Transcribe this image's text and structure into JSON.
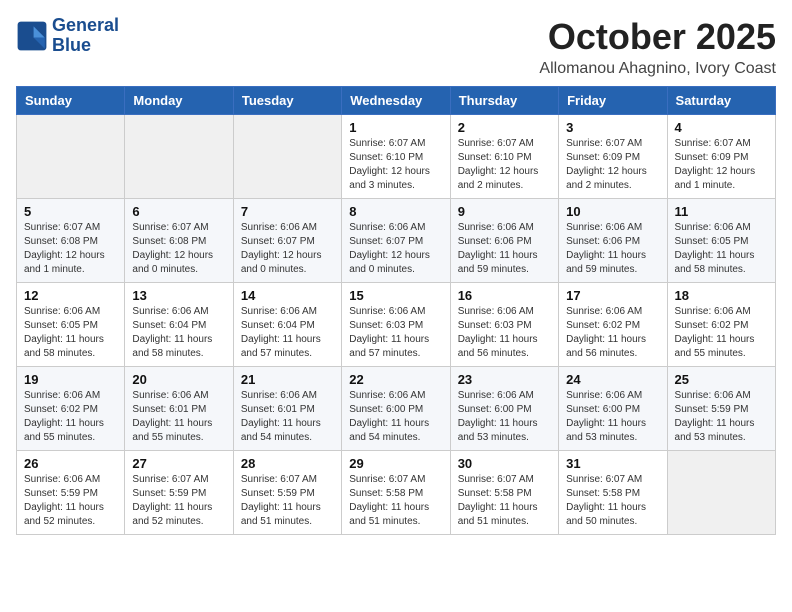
{
  "logo": {
    "line1": "General",
    "line2": "Blue"
  },
  "title": "October 2025",
  "subtitle": "Allomanou Ahagnino, Ivory Coast",
  "weekdays": [
    "Sunday",
    "Monday",
    "Tuesday",
    "Wednesday",
    "Thursday",
    "Friday",
    "Saturday"
  ],
  "weeks": [
    [
      {
        "day": "",
        "info": ""
      },
      {
        "day": "",
        "info": ""
      },
      {
        "day": "",
        "info": ""
      },
      {
        "day": "1",
        "info": "Sunrise: 6:07 AM\nSunset: 6:10 PM\nDaylight: 12 hours\nand 3 minutes."
      },
      {
        "day": "2",
        "info": "Sunrise: 6:07 AM\nSunset: 6:10 PM\nDaylight: 12 hours\nand 2 minutes."
      },
      {
        "day": "3",
        "info": "Sunrise: 6:07 AM\nSunset: 6:09 PM\nDaylight: 12 hours\nand 2 minutes."
      },
      {
        "day": "4",
        "info": "Sunrise: 6:07 AM\nSunset: 6:09 PM\nDaylight: 12 hours\nand 1 minute."
      }
    ],
    [
      {
        "day": "5",
        "info": "Sunrise: 6:07 AM\nSunset: 6:08 PM\nDaylight: 12 hours\nand 1 minute."
      },
      {
        "day": "6",
        "info": "Sunrise: 6:07 AM\nSunset: 6:08 PM\nDaylight: 12 hours\nand 0 minutes."
      },
      {
        "day": "7",
        "info": "Sunrise: 6:06 AM\nSunset: 6:07 PM\nDaylight: 12 hours\nand 0 minutes."
      },
      {
        "day": "8",
        "info": "Sunrise: 6:06 AM\nSunset: 6:07 PM\nDaylight: 12 hours\nand 0 minutes."
      },
      {
        "day": "9",
        "info": "Sunrise: 6:06 AM\nSunset: 6:06 PM\nDaylight: 11 hours\nand 59 minutes."
      },
      {
        "day": "10",
        "info": "Sunrise: 6:06 AM\nSunset: 6:06 PM\nDaylight: 11 hours\nand 59 minutes."
      },
      {
        "day": "11",
        "info": "Sunrise: 6:06 AM\nSunset: 6:05 PM\nDaylight: 11 hours\nand 58 minutes."
      }
    ],
    [
      {
        "day": "12",
        "info": "Sunrise: 6:06 AM\nSunset: 6:05 PM\nDaylight: 11 hours\nand 58 minutes."
      },
      {
        "day": "13",
        "info": "Sunrise: 6:06 AM\nSunset: 6:04 PM\nDaylight: 11 hours\nand 58 minutes."
      },
      {
        "day": "14",
        "info": "Sunrise: 6:06 AM\nSunset: 6:04 PM\nDaylight: 11 hours\nand 57 minutes."
      },
      {
        "day": "15",
        "info": "Sunrise: 6:06 AM\nSunset: 6:03 PM\nDaylight: 11 hours\nand 57 minutes."
      },
      {
        "day": "16",
        "info": "Sunrise: 6:06 AM\nSunset: 6:03 PM\nDaylight: 11 hours\nand 56 minutes."
      },
      {
        "day": "17",
        "info": "Sunrise: 6:06 AM\nSunset: 6:02 PM\nDaylight: 11 hours\nand 56 minutes."
      },
      {
        "day": "18",
        "info": "Sunrise: 6:06 AM\nSunset: 6:02 PM\nDaylight: 11 hours\nand 55 minutes."
      }
    ],
    [
      {
        "day": "19",
        "info": "Sunrise: 6:06 AM\nSunset: 6:02 PM\nDaylight: 11 hours\nand 55 minutes."
      },
      {
        "day": "20",
        "info": "Sunrise: 6:06 AM\nSunset: 6:01 PM\nDaylight: 11 hours\nand 55 minutes."
      },
      {
        "day": "21",
        "info": "Sunrise: 6:06 AM\nSunset: 6:01 PM\nDaylight: 11 hours\nand 54 minutes."
      },
      {
        "day": "22",
        "info": "Sunrise: 6:06 AM\nSunset: 6:00 PM\nDaylight: 11 hours\nand 54 minutes."
      },
      {
        "day": "23",
        "info": "Sunrise: 6:06 AM\nSunset: 6:00 PM\nDaylight: 11 hours\nand 53 minutes."
      },
      {
        "day": "24",
        "info": "Sunrise: 6:06 AM\nSunset: 6:00 PM\nDaylight: 11 hours\nand 53 minutes."
      },
      {
        "day": "25",
        "info": "Sunrise: 6:06 AM\nSunset: 5:59 PM\nDaylight: 11 hours\nand 53 minutes."
      }
    ],
    [
      {
        "day": "26",
        "info": "Sunrise: 6:06 AM\nSunset: 5:59 PM\nDaylight: 11 hours\nand 52 minutes."
      },
      {
        "day": "27",
        "info": "Sunrise: 6:07 AM\nSunset: 5:59 PM\nDaylight: 11 hours\nand 52 minutes."
      },
      {
        "day": "28",
        "info": "Sunrise: 6:07 AM\nSunset: 5:59 PM\nDaylight: 11 hours\nand 51 minutes."
      },
      {
        "day": "29",
        "info": "Sunrise: 6:07 AM\nSunset: 5:58 PM\nDaylight: 11 hours\nand 51 minutes."
      },
      {
        "day": "30",
        "info": "Sunrise: 6:07 AM\nSunset: 5:58 PM\nDaylight: 11 hours\nand 51 minutes."
      },
      {
        "day": "31",
        "info": "Sunrise: 6:07 AM\nSunset: 5:58 PM\nDaylight: 11 hours\nand 50 minutes."
      },
      {
        "day": "",
        "info": ""
      }
    ]
  ]
}
